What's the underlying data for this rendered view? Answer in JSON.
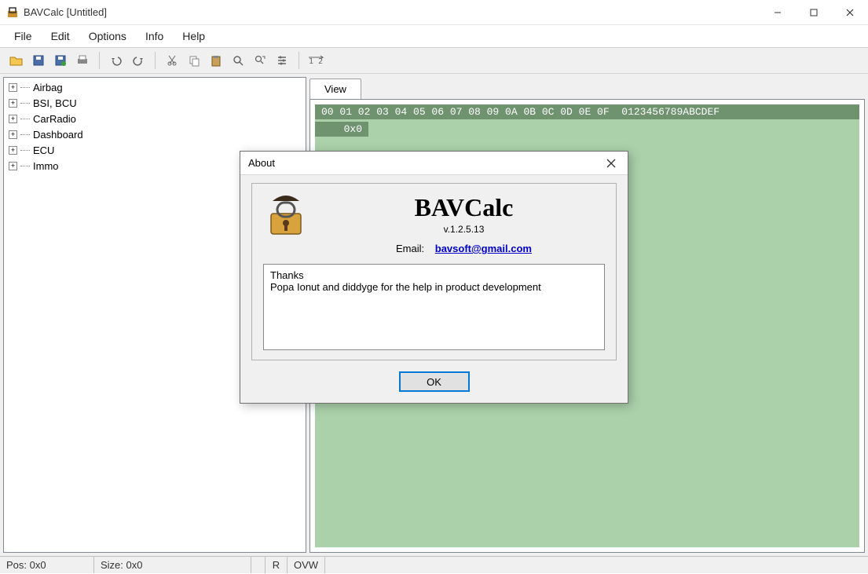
{
  "window": {
    "title": "BAVCalc [Untitled]"
  },
  "menu": {
    "file": "File",
    "edit": "Edit",
    "options": "Options",
    "info": "Info",
    "help": "Help"
  },
  "tree": {
    "items": [
      {
        "label": "Airbag"
      },
      {
        "label": "BSI, BCU"
      },
      {
        "label": "CarRadio"
      },
      {
        "label": "Dashboard"
      },
      {
        "label": "ECU"
      },
      {
        "label": "Immo"
      }
    ]
  },
  "tabs": {
    "view": "View"
  },
  "hex": {
    "header": "00 01 02 03 04 05 06 07 08 09 0A 0B 0C 0D 0E 0F  0123456789ABCDEF",
    "addr0": "0x0"
  },
  "status": {
    "pos": "Pos: 0x0",
    "size": "Size: 0x0",
    "r": "R",
    "ovw": "OVW"
  },
  "about": {
    "title": "About",
    "appname": "BAVCalc",
    "version": "v.1.2.5.13",
    "email_label": "Email:",
    "email": "bavsoft@gmail.com",
    "thanks_title": "Thanks",
    "thanks_body": "Popa Ionut and diddyge for the help in product development",
    "ok": "OK"
  }
}
